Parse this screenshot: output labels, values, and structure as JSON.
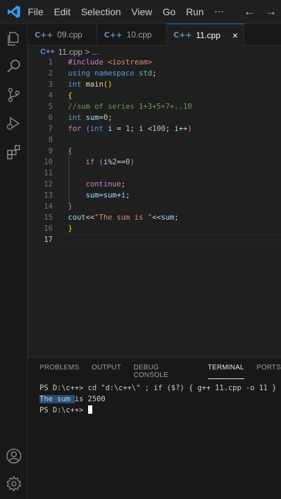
{
  "menu": [
    "File",
    "Edit",
    "Selection",
    "View",
    "Go",
    "Run",
    "⋯"
  ],
  "tabs": [
    {
      "icon": "C++",
      "label": "09.cpp"
    },
    {
      "icon": "C++",
      "label": "10.cpp"
    },
    {
      "icon": "C++",
      "label": "11.cpp",
      "close": "×"
    }
  ],
  "breadcrumb": {
    "icon": "C++",
    "file": "11.cpp",
    "sep": ">",
    "more": "..."
  },
  "editor": {
    "line_numbers": [
      "1",
      "2",
      "3",
      "4",
      "5",
      "6",
      "7",
      "8",
      "9",
      "10",
      "11",
      "12",
      "13",
      "14",
      "15",
      "16",
      "17"
    ],
    "current_line": "17"
  },
  "panel": {
    "tabs": [
      "PROBLEMS",
      "OUTPUT",
      "DEBUG CONSOLE",
      "TERMINAL",
      "PORTS"
    ],
    "active_tab": "TERMINAL",
    "terminal": {
      "prompt1": "PS D:\\c++> ",
      "command": "cd \"d:\\c++\\\" ; if ($?) { g++ 11.cpp -o 11 } ;",
      "output_selected": "The sum ",
      "output_rest": "is 2500",
      "prompt2": "PS D:\\c++> "
    }
  },
  "colors": {
    "accent": "#0078d4",
    "keyword": "#569cd6",
    "string": "#ce9178",
    "comment": "#6a9955"
  },
  "icons": [
    "vscode-logo-icon",
    "explorer-icon",
    "search-icon",
    "source-control-icon",
    "run-debug-icon",
    "extensions-icon",
    "account-icon",
    "settings-gear-icon",
    "arrow-left-icon",
    "arrow-right-icon"
  ]
}
